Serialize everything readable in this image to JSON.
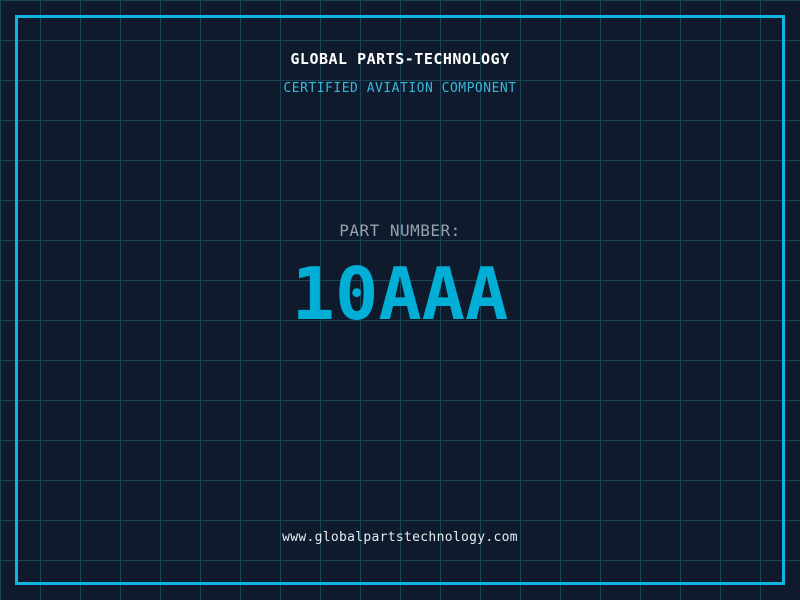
{
  "theme": {
    "background": "#0f1b2c",
    "grid_line": "#17465a",
    "frame_border": "#10b4dc",
    "title_color": "#ffffff",
    "subtitle_color": "#38b7da",
    "label_color": "#98a2ae",
    "part_number_color": "#00aed6",
    "footer_color": "#e6ecf0"
  },
  "header": {
    "title": "GLOBAL PARTS-TECHNOLOGY",
    "subtitle": "CERTIFIED AVIATION COMPONENT"
  },
  "part": {
    "label": "PART NUMBER:",
    "number": "10AAA"
  },
  "footer": {
    "website": "www.globalpartstechnology.com"
  }
}
